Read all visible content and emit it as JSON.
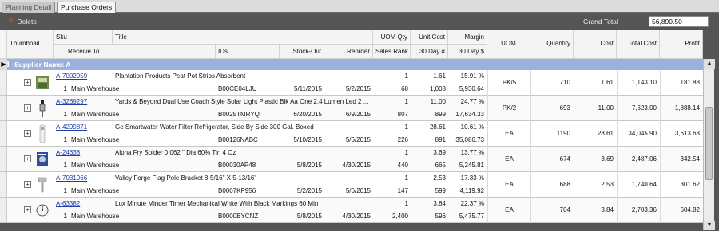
{
  "tabs": [
    {
      "label": "Planning Detail"
    },
    {
      "label": "Purchase Orders"
    }
  ],
  "toolbar": {
    "delete_label": "Delete",
    "grand_total_label": "Grand Total",
    "grand_total_value": "56,890.50"
  },
  "header": {
    "thumbnail": "Thumbnail",
    "sku": "Sku",
    "title": "Title",
    "uom_qty": "UOM Qty",
    "unit_cost": "Unit Cost",
    "margin": "Margin",
    "receive_to": "Receive To",
    "ids": "IDs",
    "stock_out": "Stock-Out",
    "reorder": "Reorder",
    "sales_rank": "Sales Rank",
    "day30": "30 Day #",
    "day30usd": "30 Day $",
    "uom": "UOM",
    "quantity": "Quantity",
    "cost": "Cost",
    "total_cost": "Total Cost",
    "profit": "Profit"
  },
  "supplier": {
    "expand": "⊟",
    "label": "Supplier Name: A"
  },
  "rows": [
    {
      "sku": "A-7002959",
      "title": "Plantation Products Peat Pot Strips Absorbent",
      "uom_qty": "1",
      "unit_cost": "1.61",
      "margin": "15.91 %",
      "qty_recv": "1",
      "warehouse": "Main Warehouse",
      "ids": "B00CE04LJU",
      "stock_out": "5/11/2015",
      "reorder": "5/2/2015",
      "sales_rank": "68",
      "d30": "1,008",
      "d30usd": "5,930.64",
      "uom": "PK/5",
      "quantity": "710",
      "cost": "1.61",
      "total_cost": "1,143.10",
      "profit": "181.88"
    },
    {
      "sku": "A-3269297",
      "title": "Yards & Beyond Dual Use Coach Style Solar Light Plastic Blk Aa One 2.4 Lumen Led 2 ...",
      "uom_qty": "1",
      "unit_cost": "11.00",
      "margin": "24.77 %",
      "qty_recv": "1",
      "warehouse": "Main Warehouse",
      "ids": "B0025TMRYQ",
      "stock_out": "6/20/2015",
      "reorder": "6/9/2015",
      "sales_rank": "807",
      "d30": "899",
      "d30usd": "17,634.33",
      "uom": "PK/2",
      "quantity": "693",
      "cost": "11.00",
      "total_cost": "7,623.00",
      "profit": "1,888.14"
    },
    {
      "sku": "A-4299871",
      "title": "Ge Smartwater Water Filter Refrigerator, Side By Side 300 Gal. Boxed",
      "uom_qty": "1",
      "unit_cost": "28.61",
      "margin": "10.61 %",
      "qty_recv": "1",
      "warehouse": "Main Warehouse",
      "ids": "B00126NABC",
      "stock_out": "5/10/2015",
      "reorder": "5/6/2015",
      "sales_rank": "226",
      "d30": "891",
      "d30usd": "35,086.73",
      "uom": "EA",
      "quantity": "1190",
      "cost": "28.61",
      "total_cost": "34,045.90",
      "profit": "3,613.63"
    },
    {
      "sku": "A-24638",
      "title": "Alpha Fry Solder 0.062 \" Dia 60% Tin 4 Oz",
      "uom_qty": "1",
      "unit_cost": "3.69",
      "margin": "13.77 %",
      "qty_recv": "1",
      "warehouse": "Main Warehouse",
      "ids": "B00030AP48",
      "stock_out": "5/8/2015",
      "reorder": "4/30/2015",
      "sales_rank": "440",
      "d30": "665",
      "d30usd": "5,245.81",
      "uom": "EA",
      "quantity": "674",
      "cost": "3.69",
      "total_cost": "2,487.06",
      "profit": "342.54"
    },
    {
      "sku": "A-7031966",
      "title": "Valley Forge Flag Pole Bracket 8-5/16\" X 5-13/16\"",
      "uom_qty": "1",
      "unit_cost": "2.53",
      "margin": "17.33 %",
      "qty_recv": "1",
      "warehouse": "Main Warehouse",
      "ids": "B0007KP956",
      "stock_out": "5/2/2015",
      "reorder": "5/6/2015",
      "sales_rank": "147",
      "d30": "599",
      "d30usd": "4,119.92",
      "uom": "EA",
      "quantity": "688",
      "cost": "2.53",
      "total_cost": "1,740.64",
      "profit": "301.62"
    },
    {
      "sku": "A-63382",
      "title": "Lux Minute Minder Timer Mechanical White With Black Markings 60 Min",
      "uom_qty": "1",
      "unit_cost": "3.84",
      "margin": "22.37 %",
      "qty_recv": "1",
      "warehouse": "Main Warehouse",
      "ids": "B0000BYCNZ",
      "stock_out": "5/8/2015",
      "reorder": "4/30/2015",
      "sales_rank": "2,400",
      "d30": "596",
      "d30usd": "5,475.77",
      "uom": "EA",
      "quantity": "704",
      "cost": "3.84",
      "total_cost": "2,703.36",
      "profit": "604.82"
    }
  ]
}
